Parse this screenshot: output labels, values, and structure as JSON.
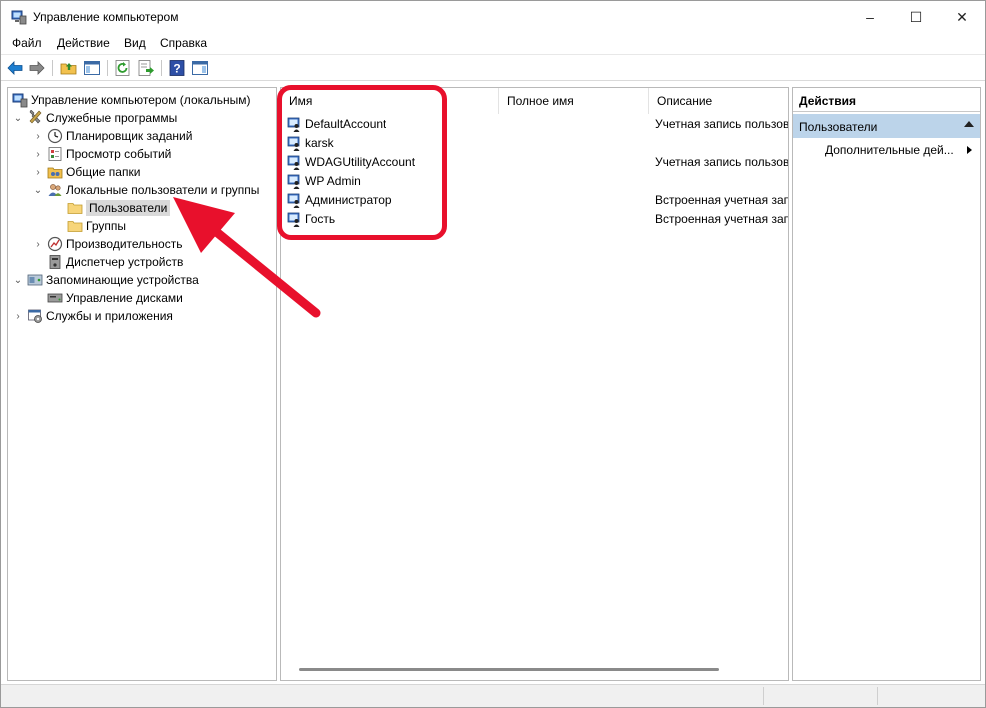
{
  "window": {
    "title": "Управление компьютером",
    "controls": {
      "minimize": "–",
      "maximize": "☐",
      "close": "✕"
    }
  },
  "menu": [
    "Файл",
    "Действие",
    "Вид",
    "Справка"
  ],
  "toolbar": [
    "back-icon",
    "forward-icon",
    "up-folder-icon",
    "show-hide-tree-icon",
    "refresh-icon",
    "export-list-icon",
    "help-icon",
    "show-hide-action-pane-icon"
  ],
  "tree": {
    "root": "Управление компьютером (локальным)",
    "items": [
      {
        "label": "Служебные программы"
      },
      {
        "label": "Планировщик заданий"
      },
      {
        "label": "Просмотр событий"
      },
      {
        "label": "Общие папки"
      },
      {
        "label": "Локальные пользователи и группы"
      },
      {
        "label": "Пользователи",
        "selected": true
      },
      {
        "label": "Группы"
      },
      {
        "label": "Производительность"
      },
      {
        "label": "Диспетчер устройств"
      },
      {
        "label": "Запоминающие устройства"
      },
      {
        "label": "Управление дисками"
      },
      {
        "label": "Службы и приложения"
      }
    ]
  },
  "list": {
    "columns": [
      "Имя",
      "Полное имя",
      "Описание"
    ],
    "rows": [
      {
        "name": "DefaultAccount",
        "full_name": "",
        "description": "Учетная запись пользов"
      },
      {
        "name": "karsk",
        "full_name": "",
        "description": ""
      },
      {
        "name": "WDAGUtilityAccount",
        "full_name": "",
        "description": "Учетная запись пользов"
      },
      {
        "name": "WP Admin",
        "full_name": "",
        "description": ""
      },
      {
        "name": "Администратор",
        "full_name": "",
        "description": "Встроенная учетная запи"
      },
      {
        "name": "Гость",
        "full_name": "",
        "description": "Встроенная учетная запи"
      }
    ]
  },
  "actions": {
    "header": "Действия",
    "section": "Пользователи",
    "items": [
      "Дополнительные дей..."
    ]
  },
  "annotation": {
    "color": "#e8102c"
  }
}
